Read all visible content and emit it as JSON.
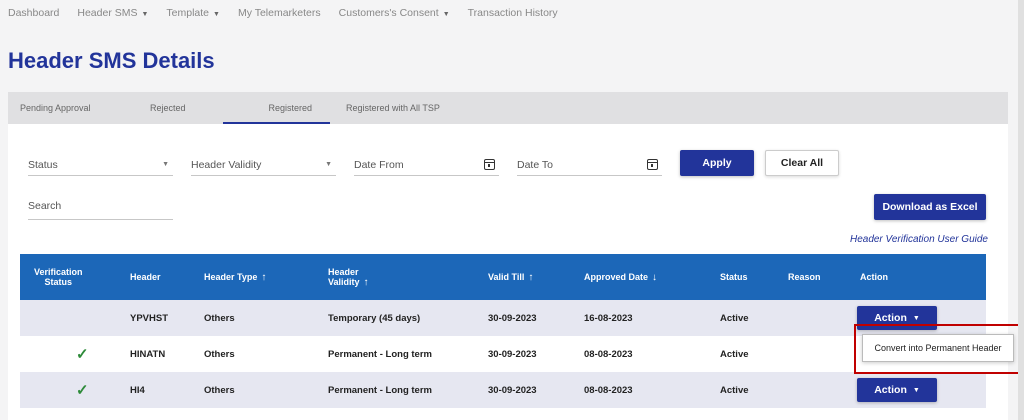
{
  "nav": {
    "items": [
      {
        "label": "Dashboard",
        "caret": false
      },
      {
        "label": "Header SMS",
        "caret": true
      },
      {
        "label": "Template",
        "caret": true
      },
      {
        "label": "My Telemarketers",
        "caret": false
      },
      {
        "label": "Customers's Consent",
        "caret": true
      },
      {
        "label": "Transaction History",
        "caret": false
      }
    ]
  },
  "page": {
    "title": "Header SMS Details"
  },
  "tabs": [
    "Pending Approval",
    "Rejected",
    "Registered",
    "Registered with All TSP"
  ],
  "active_tab": "Registered",
  "filters": {
    "status": "Status",
    "header_validity": "Header Validity",
    "date_from": "Date From",
    "date_to": "Date To",
    "apply": "Apply",
    "clear_all": "Clear All",
    "search": "Search",
    "download": "Download as Excel",
    "guide_link": "Header Verification User Guide"
  },
  "table": {
    "columns": {
      "verification_status_1": "Verification",
      "verification_status_2": "Status",
      "header": "Header",
      "header_type": "Header Type",
      "header_validity_1": "Header",
      "header_validity_2": "Validity",
      "valid_till": "Valid Till",
      "approved_date": "Approved Date",
      "status": "Status",
      "reason": "Reason",
      "action": "Action"
    },
    "rows": [
      {
        "verified": "",
        "header": "YPVHST",
        "header_type": "Others",
        "validity": "Temporary (45 days)",
        "valid_till": "30-09-2023",
        "approved_date": "16-08-2023",
        "status": "Active"
      },
      {
        "verified": "✓",
        "header": "HINATN",
        "header_type": "Others",
        "validity": "Permanent - Long term",
        "valid_till": "30-09-2023",
        "approved_date": "08-08-2023",
        "status": "Active"
      },
      {
        "verified": "✓",
        "header": "HI4",
        "header_type": "Others",
        "validity": "Permanent - Long term",
        "valid_till": "30-09-2023",
        "approved_date": "08-08-2023",
        "status": "Active"
      }
    ],
    "action_label": "Action"
  },
  "dropdown": {
    "option": "Convert into Permanent Header"
  },
  "colors": {
    "brand": "#22349a",
    "table_header": "#1c67b8",
    "highlight": "#c00000",
    "check": "#2e8b3a"
  }
}
